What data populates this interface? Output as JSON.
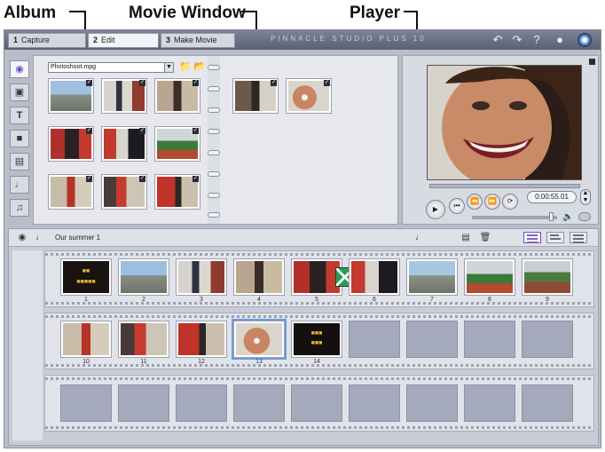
{
  "callouts": {
    "album": "Album",
    "movie_window": "Movie Window",
    "player": "Player"
  },
  "titlebar": {
    "tabs": [
      {
        "num": "1",
        "label": "Capture"
      },
      {
        "num": "2",
        "label": "Edit"
      },
      {
        "num": "3",
        "label": "Make Movie"
      }
    ],
    "active_tab": "2",
    "brand": "PINNACLE STUDIO PLUS 10",
    "icons": [
      "undo-icon",
      "redo-icon",
      "help-icon",
      "lightbulb-icon",
      "disc-icon"
    ]
  },
  "toolstrip": {
    "icons": [
      "video-icon",
      "transition-icon",
      "title-icon",
      "photo-icon",
      "menu-icon",
      "sound-effects-icon",
      "music-icon"
    ],
    "active": "video-icon"
  },
  "album": {
    "source_file": "Photoshoot.mpg",
    "icons": [
      "folder-up-icon",
      "folder-open-icon"
    ],
    "scene_count_left_page": 9,
    "scene_count_right_page": 2
  },
  "player": {
    "timecode": "0:00:55.01",
    "icons": [
      "play-icon",
      "go-to-start-icon",
      "rewind-icon",
      "fast-forward-icon",
      "loop-icon",
      "volume-icon",
      "fullscreen-icon",
      "expand-icon"
    ],
    "volume_level": 0.94
  },
  "movie_window": {
    "project_name": "Our summer 1",
    "icons": [
      "camera-icon",
      "audio-icon",
      "audio-toggle-icon",
      "razor-icon",
      "trash-icon"
    ],
    "views": [
      "storyboard-view",
      "timeline-view",
      "text-view"
    ],
    "active_view": "storyboard-view",
    "row1_numbers": [
      "1",
      "2",
      "3",
      "4",
      "5",
      "6",
      "7",
      "8",
      "9"
    ],
    "row2_numbers": [
      "10",
      "11",
      "12",
      "13",
      "14"
    ],
    "selected_clip": "13",
    "colors": {
      "accent": "#6b4fbf",
      "selection": "#6b9be0",
      "transition": "#2c9c5a"
    }
  }
}
